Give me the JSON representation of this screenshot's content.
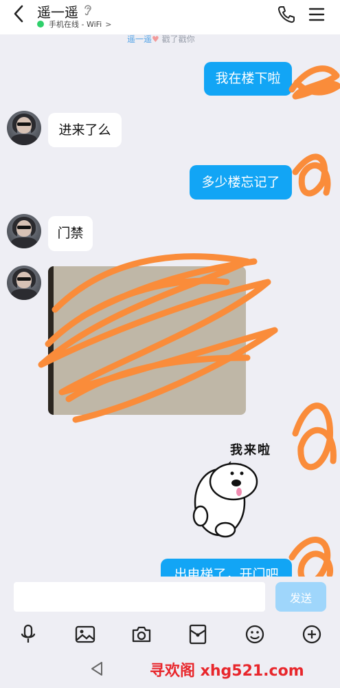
{
  "header": {
    "title": "遥一遥",
    "status_text": "手机在线 - WiFi",
    "status_chevron": ">"
  },
  "notice": {
    "name": "遥一遥",
    "text": "戳了戳你"
  },
  "messages": [
    {
      "side": "out",
      "text": "我在楼下啦"
    },
    {
      "side": "in",
      "text": "进来了么"
    },
    {
      "side": "out",
      "text": "多少楼忘记了"
    },
    {
      "side": "in",
      "text": "门禁"
    },
    {
      "side": "in",
      "type": "image"
    },
    {
      "side": "out",
      "type": "sticker",
      "text": "我来啦"
    },
    {
      "side": "out",
      "text": "出电梯了，开门吧"
    }
  ],
  "input": {
    "value": "",
    "send_label": "发送"
  },
  "toolbar": [
    "mic-icon",
    "image-icon",
    "camera-icon",
    "red-packet-icon",
    "emoji-icon",
    "plus-icon"
  ],
  "watermark": "寻欢阁 xhg521.com",
  "colors": {
    "outgoing_bubble": "#12a5f5",
    "incoming_bubble": "#ffffff",
    "background": "#eeeef4",
    "scribble": "#fa8c3a",
    "online_dot": "#2fd06b"
  }
}
